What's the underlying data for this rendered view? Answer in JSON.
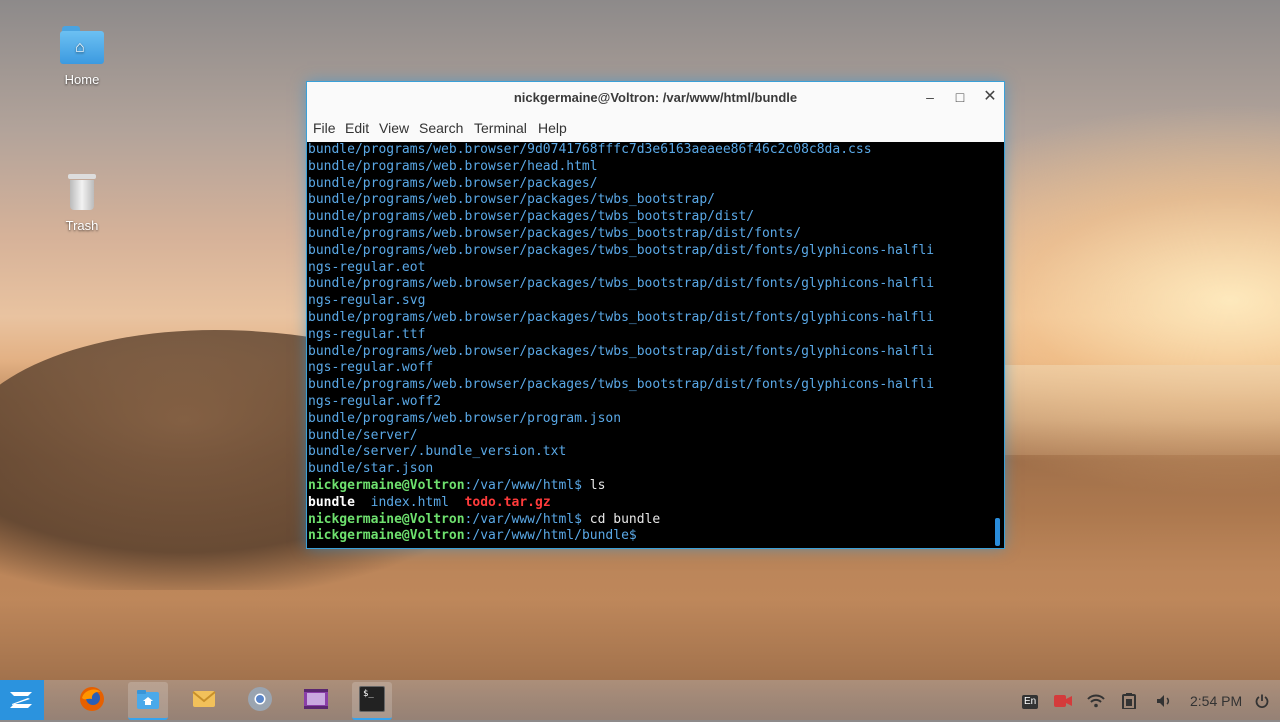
{
  "desktop": {
    "icons": [
      {
        "label": "Home",
        "icon": "home-folder-icon"
      },
      {
        "label": "Trash",
        "icon": "trash-icon"
      }
    ]
  },
  "window": {
    "title": "nickgermaine@Voltron: /var/www/html/bundle",
    "controls": {
      "minimize": "–",
      "maximize": "□",
      "close": "✕"
    },
    "menu": [
      "File",
      "Edit",
      "View",
      "Search",
      "Terminal",
      "Help"
    ]
  },
  "terminal": {
    "output_lines": [
      "bundle/programs/web.browser/9d0741768fffc7d3e6163aeaee86f46c2c08c8da.css",
      "bundle/programs/web.browser/head.html",
      "bundle/programs/web.browser/packages/",
      "bundle/programs/web.browser/packages/twbs_bootstrap/",
      "bundle/programs/web.browser/packages/twbs_bootstrap/dist/",
      "bundle/programs/web.browser/packages/twbs_bootstrap/dist/fonts/",
      "bundle/programs/web.browser/packages/twbs_bootstrap/dist/fonts/glyphicons-halfli",
      "ngs-regular.eot",
      "bundle/programs/web.browser/packages/twbs_bootstrap/dist/fonts/glyphicons-halfli",
      "ngs-regular.svg",
      "bundle/programs/web.browser/packages/twbs_bootstrap/dist/fonts/glyphicons-halfli",
      "ngs-regular.ttf",
      "bundle/programs/web.browser/packages/twbs_bootstrap/dist/fonts/glyphicons-halfli",
      "ngs-regular.woff",
      "bundle/programs/web.browser/packages/twbs_bootstrap/dist/fonts/glyphicons-halfli",
      "ngs-regular.woff2",
      "bundle/programs/web.browser/program.json",
      "bundle/server/",
      "bundle/server/.bundle_version.txt",
      "bundle/star.json"
    ],
    "prompt_user": "nickgermaine@Voltron",
    "prompt1_path": ":/var/www/html$ ",
    "cmd1": "ls",
    "ls_items": [
      "bundle",
      "index.html",
      "todo.tar.gz"
    ],
    "prompt2_path": ":/var/www/html$ ",
    "cmd2": "cd bundle",
    "prompt3_path": ":/var/www/html/bundle$ "
  },
  "taskbar": {
    "apps": [
      "zorin-menu-icon",
      "firefox-icon",
      "files-icon",
      "mail-icon",
      "chrome-icon",
      "video-editor-icon",
      "terminal-icon"
    ],
    "terminal_label": "$_",
    "tray": {
      "language": "En",
      "clock": "2:54 PM"
    }
  },
  "colors": {
    "accent": "#2b93de",
    "prompt_green": "#6ee06e",
    "path_blue": "#5aa8e6",
    "archive_red": "#ff3b3b"
  }
}
